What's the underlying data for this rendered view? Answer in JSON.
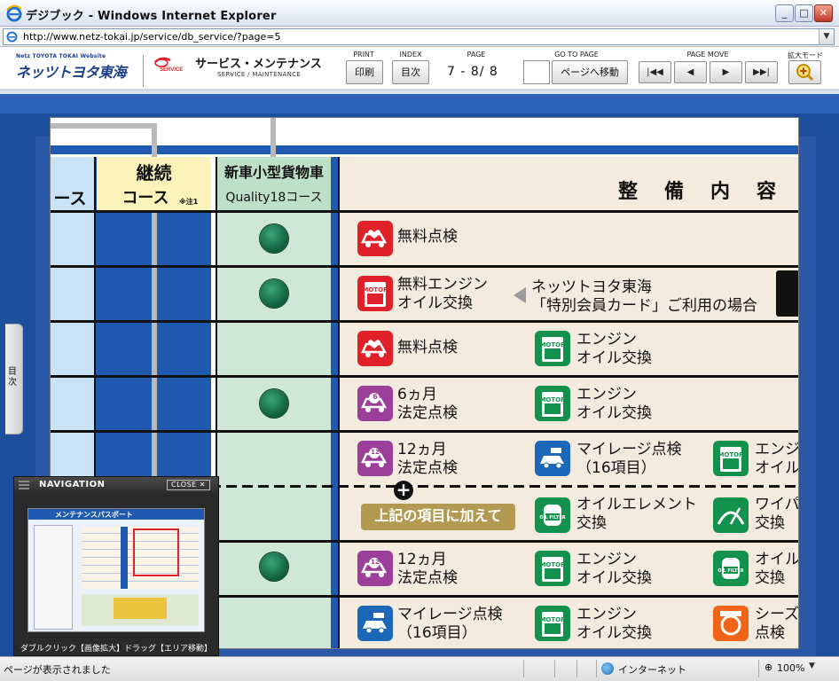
{
  "window": {
    "title": "デジブック - Windows Internet Explorer",
    "url": "http://www.netz-tokai.jp/service/db_service/?page=5"
  },
  "site": {
    "logo_small": "Netz TOYOTA TOKAI Website",
    "logo_big": "ネッツトヨタ東海",
    "service_logo_text": "SERVICE",
    "service_title": "サービス・メンテナンス",
    "service_sub": "SERVICE / MAINTENANCE"
  },
  "toolbar": {
    "print_label": "PRINT",
    "print_button": "印刷",
    "index_label": "INDEX",
    "index_button": "目次",
    "page_label": "PAGE",
    "page_value": "7 - 8/ 8",
    "goto_label": "GO TO PAGE",
    "goto_button": "ページへ移動",
    "goto_input": "",
    "move_label": "PAGE MOVE",
    "zoom_label": "拡大モード"
  },
  "toc_tab": "目次",
  "doc": {
    "col_prev_header": "ース",
    "col_keizoku_header_1": "継続",
    "col_keizoku_header_2": "コース",
    "col_keizoku_note": "※注1",
    "col_newcar_header_1": "新車小型貨物車",
    "col_newcar_header_2": "Quality18コース",
    "col_content_header": "整　備　内　容",
    "rows": [
      {
        "icon1": "無料点検"
      },
      {
        "icon1_a": "無料エンジン",
        "icon1_b": "オイル交換",
        "note_a": "ネッツトヨタ東海",
        "note_b": "「特別会員カード」ご利用の場合"
      },
      {
        "icon1": "無料点検",
        "icon2_a": "エンジン",
        "icon2_b": "オイル交換"
      },
      {
        "icon1_a": "6ヵ月",
        "icon1_b": "法定点検",
        "icon2_a": "エンジン",
        "icon2_b": "オイル交換"
      },
      {
        "icon1_a": "12ヵ月",
        "icon1_b": "法定点検",
        "icon2_a": "マイレージ点検",
        "icon2_b": "（16項目）",
        "icon3_a": "エンジ",
        "icon3_b": "オイル"
      },
      {
        "pill": "上記の項目に加えて",
        "icon2_a": "オイルエレメント",
        "icon2_b": "交換",
        "icon3_a": "ワイパ",
        "icon3_b": "交換"
      },
      {
        "icon1_a": "12ヵ月",
        "icon1_b": "法定点検",
        "icon2_a": "エンジン",
        "icon2_b": "オイル交換",
        "icon3_a": "オイル",
        "icon3_b": "交換"
      },
      {
        "icon1_a": "マイレージ点検",
        "icon1_b": "（16項目）",
        "icon2_a": "エンジン",
        "icon2_b": "オイル交換",
        "icon3_a": "シーズ",
        "icon3_b": "点検"
      }
    ],
    "icon_labels": {
      "motor_oil": "MOTOR OIL",
      "oil_filter": "OIL FILTER",
      "six": "6",
      "twelve": "12"
    }
  },
  "navigation": {
    "title": "NAVIGATION",
    "close": "CLOSE ✕",
    "footer": "ダブルクリック【画像拡大】ドラッグ【エリア移動】",
    "thumb_title": "メンテナンスパスポート"
  },
  "status": {
    "message": "ページが表示されました",
    "zone": "インターネット",
    "zoom": "100%"
  },
  "colors": {
    "blue": "#1f5ab0",
    "red_icon": "#e0212a",
    "purple_icon": "#9b3f9a",
    "green_icon": "#13924e",
    "gold_pill": "#b39a52"
  }
}
